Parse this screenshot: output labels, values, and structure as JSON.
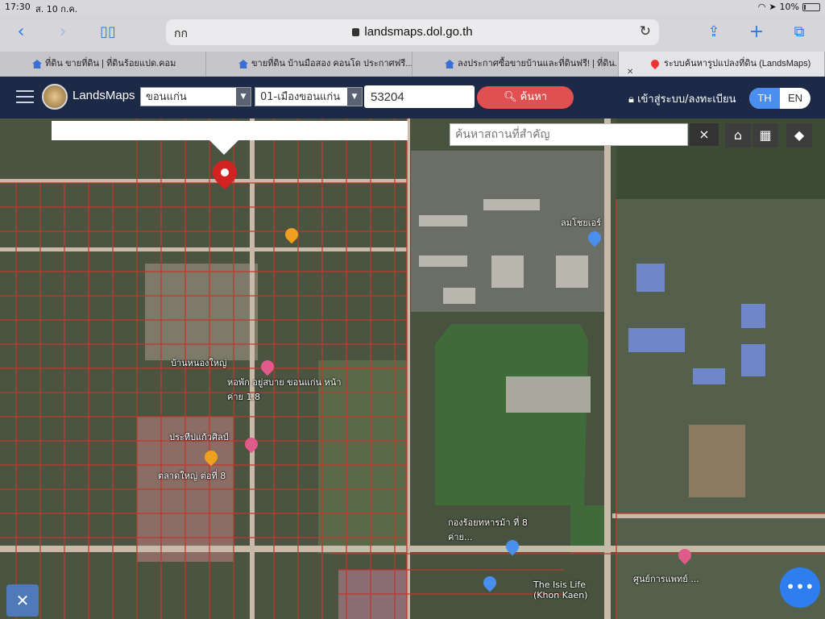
{
  "status": {
    "time": "17:30",
    "date": "ส. 10 ก.ค.",
    "battery": "10%"
  },
  "browser": {
    "text_size_label": "กก",
    "url": "landsmaps.dol.go.th",
    "tabs": [
      {
        "label": "ที่ดิน ขายที่ดิน | ที่ดินร้อยแปด.คอม"
      },
      {
        "label": "ขายที่ดิน บ้านมือสอง คอนโด ประกาศฟรี..."
      },
      {
        "label": "ลงประกาศซื้อขายบ้านและที่ดินฟรี! | ที่ดิน..."
      },
      {
        "label": "ระบบค้นหารูปแปลงที่ดิน (LandsMaps)"
      }
    ]
  },
  "app": {
    "name": "LandsMaps",
    "province": "ขอนแก่น",
    "district": "01-เมืองขอนแก่น",
    "parcel_no": "53204",
    "search_label": "ค้นหา",
    "login_label": "เข้าสู่ระบบ/ลงทะเบียน",
    "lang_th": "TH",
    "lang_en": "EN"
  },
  "map": {
    "place_search_placeholder": "ค้นหาสถานที่สำคัญ",
    "clear_label": "×",
    "labels": [
      {
        "text": "ลมโชยเอร์"
      },
      {
        "text": "บ้านหนองใหญ่"
      },
      {
        "text": "หอพัก อยู่สบาย ขอนแก่น หน้าค่าย 1.8"
      },
      {
        "text": "ประทีปแก้วศิลป์"
      },
      {
        "text": "ตลาดใหญ่ ต่อที่ 8"
      },
      {
        "text": "กองร้อยทหารม้า ที่ 8 ค่าย..."
      },
      {
        "text": "The Isis Life (Khon Kaen)"
      },
      {
        "text": "ศูนย์การแพทย์ ..."
      }
    ]
  },
  "icons": {
    "back": "chevron-left-icon",
    "forward": "chevron-right-icon",
    "reader": "book-icon",
    "share": "share-icon",
    "new_tab": "plus-icon",
    "tabs": "tabs-icon",
    "home": "home-icon",
    "grid": "grid-icon",
    "layers": "layers-icon"
  },
  "colors": {
    "appbar": "#1c2a48",
    "search_button": "#e05050",
    "lang_active": "#4a8ef0",
    "parcel_line": "#c0392b"
  }
}
